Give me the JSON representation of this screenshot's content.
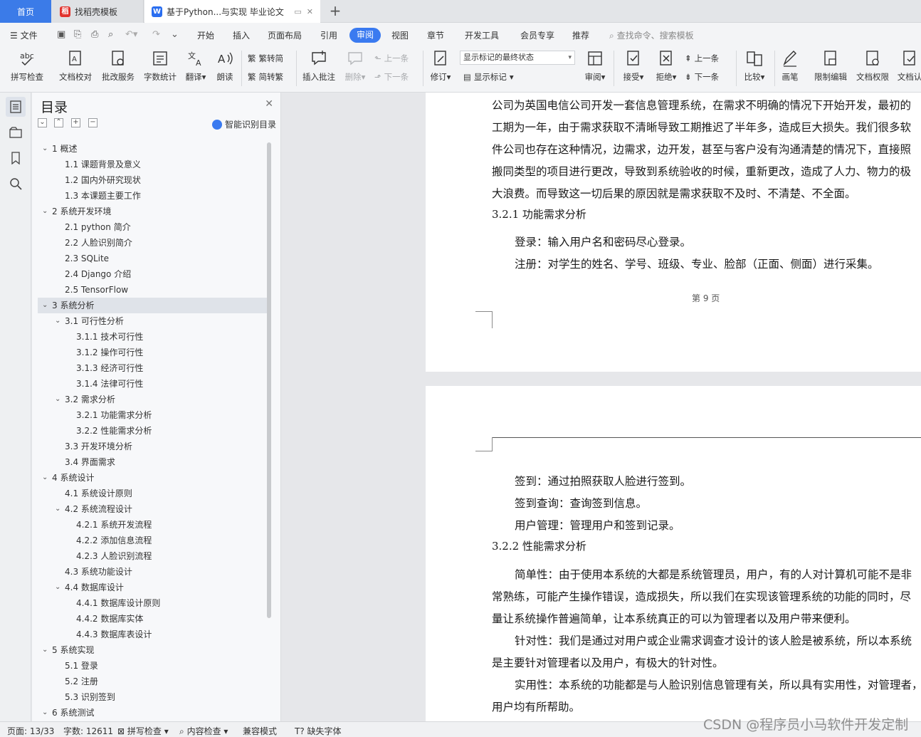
{
  "tabs": {
    "home": "首页",
    "templates": "找稻壳模板",
    "document": "基于Python...与实现 毕业论文"
  },
  "menu": {
    "file": "文件",
    "items": [
      "开始",
      "插入",
      "页面布局",
      "引用",
      "审阅",
      "视图",
      "章节",
      "开发工具",
      "会员专享",
      "推荐"
    ],
    "active": "审阅",
    "search_placeholder": "查找命令、搜索模板"
  },
  "ribbon": {
    "spell_check": "拼写检查",
    "doc_proofread": "文档校对",
    "annotate_service": "批改服务",
    "word_count": "字数统计",
    "translate": "翻译",
    "read_aloud": "朗读",
    "trad_to_simp": "繁转简",
    "simp_to_trad": "简转繁",
    "insert_comment": "插入批注",
    "delete": "删除",
    "prev_comment": "上一条",
    "next_comment": "下一条",
    "track_changes": "修订",
    "markup_state": "显示标记的最终状态",
    "show_markup": "显示标记",
    "review": "审阅",
    "accept": "接受",
    "reject": "拒绝",
    "prev_change": "上一条",
    "next_change": "下一条",
    "compare": "比较",
    "pen": "画笔",
    "restrict_edit": "限制编辑",
    "doc_permission": "文档权限",
    "doc_auth": "文档认"
  },
  "toc": {
    "title": "目录",
    "smart_label": "智能识别目录",
    "items": [
      {
        "text": "1  概述",
        "level": 1,
        "caret": "open"
      },
      {
        "text": "1.1 课题背景及意义",
        "level": 2
      },
      {
        "text": "1.2  国内外研究现状",
        "level": 2
      },
      {
        "text": "1.3  本课题主要工作",
        "level": 2
      },
      {
        "text": "2  系统开发环境",
        "level": 1,
        "caret": "open"
      },
      {
        "text": "2.1 python 简介",
        "level": 2
      },
      {
        "text": "2.2  人脸识别简介",
        "level": 2
      },
      {
        "text": "2.3 SQLite",
        "level": 2
      },
      {
        "text": "2.4 Django 介绍",
        "level": 2
      },
      {
        "text": "2.5 TensorFlow",
        "level": 2
      },
      {
        "text": "3  系统分析",
        "level": 1,
        "caret": "open",
        "selected": true
      },
      {
        "text": "3.1  可行性分析",
        "level": 2,
        "caret": "open"
      },
      {
        "text": "3.1.1  技术可行性",
        "level": 3
      },
      {
        "text": "3.1.2 操作可行性",
        "level": 3
      },
      {
        "text": "3.1.3  经济可行性",
        "level": 3
      },
      {
        "text": "3.1.4  法律可行性",
        "level": 3
      },
      {
        "text": "3.2 需求分析",
        "level": 2,
        "caret": "open"
      },
      {
        "text": "3.2.1  功能需求分析",
        "level": 3
      },
      {
        "text": "3.2.2  性能需求分析",
        "level": 3
      },
      {
        "text": "3.3 开发环境分析",
        "level": 2
      },
      {
        "text": "3.4 界面需求",
        "level": 2
      },
      {
        "text": "4  系统设计",
        "level": 1,
        "caret": "open"
      },
      {
        "text": "4.1 系统设计原则",
        "level": 2
      },
      {
        "text": "4.2 系统流程设计",
        "level": 2,
        "caret": "open"
      },
      {
        "text": "4.2.1 系统开发流程",
        "level": 3
      },
      {
        "text": "4.2.2  添加信息流程",
        "level": 3
      },
      {
        "text": "4.2.3  人脸识别流程",
        "level": 3
      },
      {
        "text": "4.3  系统功能设计",
        "level": 2
      },
      {
        "text": "4.4  数据库设计",
        "level": 2,
        "caret": "open"
      },
      {
        "text": "4.4.1  数据库设计原则",
        "level": 3
      },
      {
        "text": "4.4.2  数据库实体",
        "level": 3
      },
      {
        "text": "4.4.3  数据库表设计",
        "level": 3
      },
      {
        "text": "5 系统实现",
        "level": 1,
        "caret": "open"
      },
      {
        "text": "5.1  登录",
        "level": 2
      },
      {
        "text": "5.2  注册",
        "level": 2
      },
      {
        "text": "5.3  识别签到",
        "level": 2
      },
      {
        "text": "6 系统测试",
        "level": 1,
        "caret": "open"
      }
    ]
  },
  "document": {
    "page1_lines": [
      "公司为英国电信公司开发一套信息管理系统，在需求不明确的情况下开始开发，最初的",
      "工期为一年，由于需求获取不清晰导致工期推迟了半年多，造成巨大损失。我们很多软",
      "件公司也存在这种情况，边需求，边开发，甚至与客户没有沟通清楚的情况下，直接照",
      "搬同类型的项目进行更改，导致到系统验收的时候，重新更改，造成了人力、物力的极",
      "大浪费。而导致这一切后果的原因就是需求获取不及时、不清楚、不全面。"
    ],
    "heading_321": "3.2.1  功能需求分析",
    "login_line": "登录：输入用户名和密码尽心登录。",
    "register_line": "注册：对学生的姓名、学号、班级、专业、脸部（正面、侧面）进行采集。",
    "page_label": "第  9  页",
    "page2_lines_a": [
      "签到：通过拍照获取人脸进行签到。",
      "签到查询：查询签到信息。",
      "用户管理：管理用户和签到记录。"
    ],
    "heading_322": "3.2.2  性能需求分析",
    "page2_lines_b": [
      "简单性：由于使用本系统的大都是系统管理员，用户，有的人对计算机可能不是非",
      "常熟练，可能产生操作错误，造成损失，所以我们在实现该管理系统的功能的同时，尽",
      "量让系统操作普遍简单，让本系统真正的可以为管理者以及用户带来便利。",
      "针对性：我们是通过对用户或企业需求调查才设计的该人脸是被系统，所以本系统",
      "是主要针对管理者以及用户，有极大的针对性。",
      "实用性：本系统的功能都是与人脸识别信息管理有关，所以具有实用性，对管理者，",
      "用户均有所帮助。"
    ]
  },
  "status": {
    "page": "页面: 13/33",
    "words": "字数: 12611",
    "spell": "拼写检查",
    "content_check": "内容检查",
    "compat": "兼容模式",
    "missing_font": "缺失字体"
  },
  "watermark": "CSDN @程序员小马软件开发定制",
  "colors": {
    "accent": "#3a7af0",
    "home_tab": "#3b7be8",
    "templates_icon": "#e2332d"
  }
}
